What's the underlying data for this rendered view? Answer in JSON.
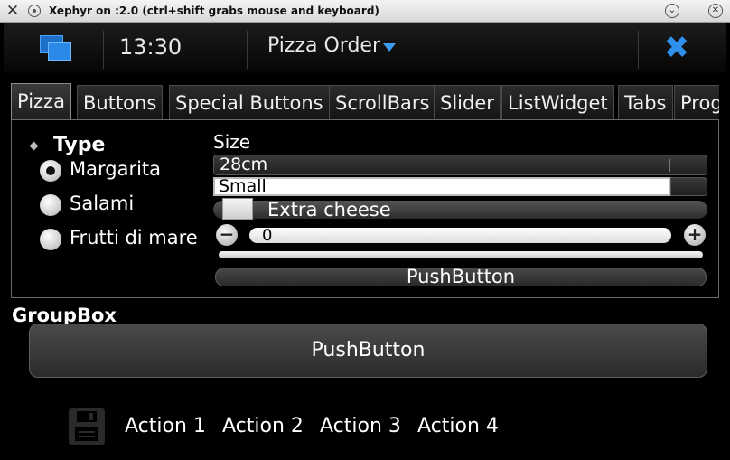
{
  "window": {
    "title": "Xephyr on :2.0 (ctrl+shift grabs mouse and keyboard)",
    "logo_glyph": "✕",
    "minimize_glyph": "⌄",
    "close_glyph": "✕"
  },
  "statusbar": {
    "time": "13:30",
    "app_title": "Pizza Order",
    "close_glyph": "✖",
    "accent_color": "#2d90ec"
  },
  "tabs": [
    {
      "label": "Pizza",
      "active": true
    },
    {
      "label": "Buttons"
    },
    {
      "label": "Special Buttons"
    },
    {
      "label": "ScrollBars"
    },
    {
      "label": "Slider"
    },
    {
      "label": "ListWidget"
    },
    {
      "label": "Tabs"
    },
    {
      "label": "Prog"
    }
  ],
  "pizza": {
    "type_title": "Type",
    "radios": [
      {
        "label": "Margarita",
        "checked": true
      },
      {
        "label": "Salami",
        "checked": false
      },
      {
        "label": "Frutti di mare",
        "checked": false
      }
    ],
    "size_label": "Size",
    "size_combo_value": "28cm",
    "size_edit_value": "Small",
    "extra_cheese_label": "Extra cheese",
    "extra_cheese_checked": false,
    "spin_minus": "−",
    "spin_plus": "+",
    "spin_value": "0",
    "slider_value": 0,
    "push_button_label": "PushButton"
  },
  "groupbox": {
    "title": "GroupBox",
    "push_button_label": "PushButton"
  },
  "toolbar": {
    "save_icon": "save-icon",
    "actions": [
      "Action 1",
      "Action 2",
      "Action 3",
      "Action 4"
    ]
  }
}
